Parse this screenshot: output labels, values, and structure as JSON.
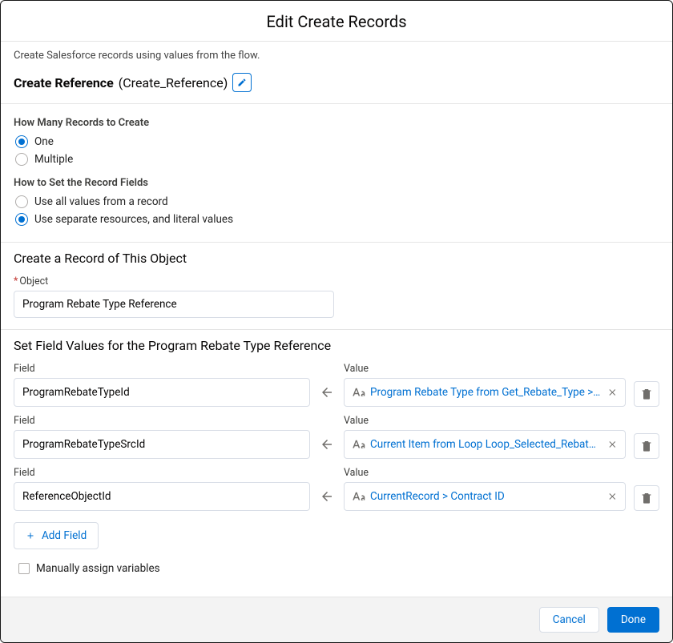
{
  "header": {
    "title": "Edit Create Records"
  },
  "intro": {
    "description": "Create Salesforce records using values from the flow.",
    "name_label": "Create Reference",
    "api_name": "(Create_Reference)"
  },
  "howMany": {
    "heading": "How Many Records to Create",
    "options": [
      "One",
      "Multiple"
    ],
    "selected": "One"
  },
  "howSet": {
    "heading": "How to Set the Record Fields",
    "options": [
      "Use all values from a record",
      "Use separate resources, and literal values"
    ],
    "selected": "Use separate resources, and literal values"
  },
  "objectSection": {
    "heading": "Create a Record of This Object",
    "label": "Object",
    "value": "Program Rebate Type Reference"
  },
  "fieldSection": {
    "heading": "Set Field Values for the Program Rebate Type Reference",
    "fieldLabel": "Field",
    "valueLabel": "Value",
    "rows": [
      {
        "field": "ProgramRebateTypeId",
        "value": "Program Rebate Type from Get_Rebate_Type > Pro…"
      },
      {
        "field": "ProgramRebateTypeSrcId",
        "value": "Current Item from Loop Loop_Selected_Rebate_Ty…"
      },
      {
        "field": "ReferenceObjectId",
        "value": "CurrentRecord > Contract ID"
      }
    ],
    "addField": "Add Field",
    "manualAssign": "Manually assign variables"
  },
  "footer": {
    "cancel": "Cancel",
    "done": "Done"
  }
}
